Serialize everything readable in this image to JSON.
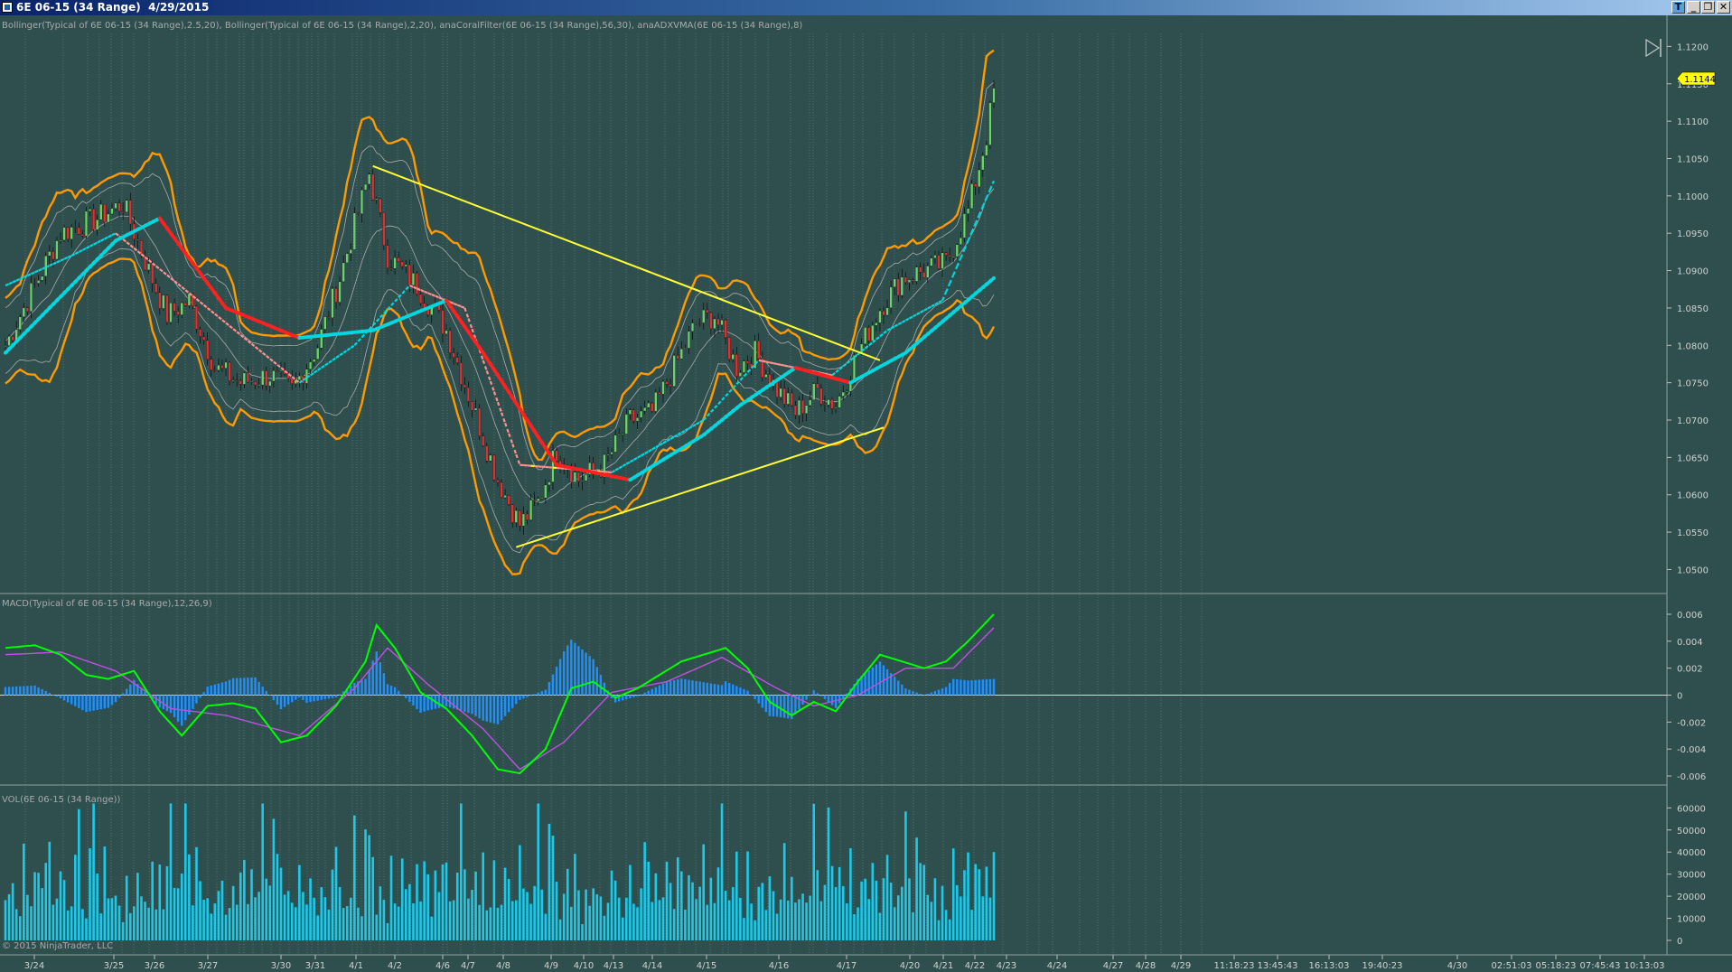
{
  "window": {
    "title": "6E 06-15 (34 Range)  4/29/2015",
    "buttons": [
      "_",
      "❐",
      "✕"
    ],
    "extra_button": "T"
  },
  "panels": {
    "price": {
      "label": "Bollinger(Typical of 6E 06-15 (34 Range),2.5,20), Bollinger(Typical of 6E 06-15 (34 Range),2,20), anaCoralFilter(6E 06-15 (34 Range),56,30), anaADXVMA(6E 06-15 (34 Range),8)",
      "last_price": "1.1144",
      "yaxis_labels": [
        "1.1200",
        "1.1150",
        "1.1100",
        "1.1050",
        "1.1000",
        "1.0950",
        "1.0900",
        "1.0850",
        "1.0800",
        "1.0750",
        "1.0700",
        "1.0650",
        "1.0600",
        "1.0550",
        "1.0500"
      ]
    },
    "macd": {
      "label": "MACD(Typical of 6E 06-15 (34 Range),12,26,9)",
      "yaxis_labels": [
        "0.006",
        "0.004",
        "0.002",
        "0",
        "-0.002",
        "-0.004",
        "-0.006"
      ]
    },
    "volume": {
      "label": "VOL(6E 06-15 (34 Range))",
      "copyright": "© 2015 NinjaTrader, LLC",
      "yaxis_labels": [
        "60000",
        "50000",
        "40000",
        "30000",
        "20000",
        "10000",
        "0"
      ]
    }
  },
  "xaxis_labels": [
    "3/24",
    "3/25",
    "3/26",
    "3/27",
    "3/30",
    "3/31",
    "4/1",
    "4/2",
    "4/6",
    "4/7",
    "4/8",
    "4/9",
    "4/10",
    "4/13",
    "4/14",
    "4/15",
    "4/16",
    "4/17",
    "4/20",
    "4/21",
    "4/22",
    "4/23",
    "4/24",
    "4/27",
    "4/28",
    "4/29",
    "11:18:23",
    "13:45:43",
    "16:13:03",
    "19:40:23",
    "4/30",
    "02:51:03",
    "05:18:23",
    "07:45:43",
    "10:13:03"
  ],
  "colors": {
    "background": "#2f4f4f",
    "bollinger_outer": "#ff9900",
    "bollinger_inner": "#a9a9a9",
    "coral_up": "#00d8e0",
    "coral_down": "#ff2020",
    "adxvma_flat": "#ffff00",
    "trendline": "#ffff33",
    "macd_line": "#00ff00",
    "signal_line": "#c050e0",
    "histogram": "#1e90ff",
    "volume_bars": "#1ec8e8",
    "candle_up": "#6cd36c",
    "candle_down": "#e03030"
  },
  "chart_data": [
    {
      "type": "candlestick",
      "title": "6E 06-15 (34 Range)",
      "ylim": [
        1.048,
        1.1215
      ],
      "grid": true,
      "anchors_price": [
        [
          0,
          1.08
        ],
        [
          8,
          1.088
        ],
        [
          15,
          1.095
        ],
        [
          25,
          1.097
        ],
        [
          32,
          1.099
        ],
        [
          39,
          1.09
        ],
        [
          44,
          1.084
        ],
        [
          50,
          1.086
        ],
        [
          57,
          1.077
        ],
        [
          64,
          1.075
        ],
        [
          72,
          1.076
        ],
        [
          78,
          1.074
        ],
        [
          85,
          1.08
        ],
        [
          91,
          1.089
        ],
        [
          99,
          1.103
        ],
        [
          104,
          1.092
        ],
        [
          112,
          1.088
        ],
        [
          120,
          1.082
        ],
        [
          127,
          1.072
        ],
        [
          134,
          1.062
        ],
        [
          140,
          1.056
        ],
        [
          145,
          1.059
        ],
        [
          150,
          1.066
        ],
        [
          156,
          1.062
        ],
        [
          163,
          1.064
        ],
        [
          170,
          1.07
        ],
        [
          176,
          1.071
        ],
        [
          182,
          1.077
        ],
        [
          188,
          1.083
        ],
        [
          193,
          1.084
        ],
        [
          199,
          1.077
        ],
        [
          204,
          1.079
        ],
        [
          210,
          1.074
        ],
        [
          215,
          1.071
        ],
        [
          221,
          1.074
        ],
        [
          226,
          1.072
        ],
        [
          232,
          1.079
        ],
        [
          238,
          1.085
        ],
        [
          244,
          1.089
        ],
        [
          250,
          1.09
        ],
        [
          256,
          1.091
        ],
        [
          262,
          1.098
        ],
        [
          267,
          1.108
        ],
        [
          269,
          1.114
        ]
      ],
      "coral_filter": [
        [
          0,
          1.079
        ],
        [
          30,
          1.094
        ],
        [
          42,
          1.097
        ],
        [
          60,
          1.085
        ],
        [
          80,
          1.081
        ],
        [
          100,
          1.082
        ],
        [
          120,
          1.086
        ],
        [
          130,
          1.079
        ],
        [
          150,
          1.064
        ],
        [
          170,
          1.062
        ],
        [
          190,
          1.068
        ],
        [
          200,
          1.072
        ],
        [
          215,
          1.077
        ],
        [
          230,
          1.075
        ],
        [
          245,
          1.079
        ],
        [
          269,
          1.089
        ]
      ],
      "adxvma": [
        [
          0,
          1.088
        ],
        [
          18,
          1.092
        ],
        [
          30,
          1.095
        ],
        [
          50,
          1.087
        ],
        [
          80,
          1.075
        ],
        [
          95,
          1.08
        ],
        [
          110,
          1.088
        ],
        [
          125,
          1.085
        ],
        [
          140,
          1.064
        ],
        [
          165,
          1.063
        ],
        [
          190,
          1.07
        ],
        [
          205,
          1.078
        ],
        [
          225,
          1.076
        ],
        [
          240,
          1.082
        ],
        [
          255,
          1.086
        ],
        [
          269,
          1.102
        ]
      ],
      "trendlines": [
        {
          "from": [
            100,
            1.104
          ],
          "to": [
            238,
            1.078
          ]
        },
        {
          "from": [
            139,
            1.053
          ],
          "to": [
            239,
            1.069
          ]
        }
      ]
    },
    {
      "type": "line",
      "title": "MACD(Typical of 6E 06-15 (34 Range),12,26,9)",
      "ylim": [
        -0.0064,
        0.0062
      ],
      "series": [
        {
          "values": [
            [
              0,
              0.0035
            ],
            [
              8,
              0.0037
            ],
            [
              15,
              0.003
            ],
            [
              22,
              0.0015
            ],
            [
              28,
              0.0012
            ],
            [
              35,
              0.0018
            ],
            [
              42,
              -0.0012
            ],
            [
              48,
              -0.003
            ],
            [
              55,
              -0.0008
            ],
            [
              62,
              -0.0006
            ],
            [
              68,
              -0.001
            ],
            [
              75,
              -0.0035
            ],
            [
              82,
              -0.003
            ],
            [
              90,
              -0.0008
            ],
            [
              98,
              0.0025
            ],
            [
              101,
              0.0052
            ],
            [
              106,
              0.0035
            ],
            [
              113,
              0.0002
            ],
            [
              120,
              -0.001
            ],
            [
              127,
              -0.003
            ],
            [
              134,
              -0.0055
            ],
            [
              140,
              -0.0058
            ],
            [
              147,
              -0.004
            ],
            [
              154,
              0.0005
            ],
            [
              160,
              0.001
            ],
            [
              166,
              -0.0002
            ],
            [
              172,
              0.0005
            ],
            [
              178,
              0.0015
            ],
            [
              184,
              0.0025
            ],
            [
              190,
              0.003
            ],
            [
              196,
              0.0035
            ],
            [
              202,
              0.002
            ],
            [
              208,
              -0.0005
            ],
            [
              214,
              -0.0015
            ],
            [
              220,
              -0.0005
            ],
            [
              226,
              -0.0012
            ],
            [
              232,
              0.001
            ],
            [
              238,
              0.003
            ],
            [
              244,
              0.0025
            ],
            [
              250,
              0.002
            ],
            [
              256,
              0.0025
            ],
            [
              262,
              0.004
            ],
            [
              269,
              0.006
            ]
          ]
        },
        {
          "values": [
            [
              0,
              0.003
            ],
            [
              15,
              0.0032
            ],
            [
              30,
              0.0018
            ],
            [
              45,
              -0.001
            ],
            [
              60,
              -0.0015
            ],
            [
              80,
              -0.003
            ],
            [
              95,
              0.0005
            ],
            [
              104,
              0.0035
            ],
            [
              115,
              0.0008
            ],
            [
              130,
              -0.0025
            ],
            [
              140,
              -0.0055
            ],
            [
              152,
              -0.0035
            ],
            [
              165,
              0.0002
            ],
            [
              180,
              0.001
            ],
            [
              195,
              0.0028
            ],
            [
              210,
              0.0005
            ],
            [
              220,
              -0.0008
            ],
            [
              232,
              0.0
            ],
            [
              245,
              0.002
            ],
            [
              258,
              0.002
            ],
            [
              269,
              0.005
            ]
          ]
        }
      ],
      "histogram": true
    },
    {
      "type": "bar",
      "title": "VOL(6E 06-15 (34 Range))",
      "ylim": [
        0,
        63000
      ],
      "bar_count": 270,
      "note_values_sampled": [
        27000,
        17000,
        30000,
        25000,
        14000,
        33000,
        21000,
        12000,
        29000,
        22000,
        18000,
        26000,
        35000,
        13000,
        25000,
        31000,
        19000,
        24000,
        16000,
        28000,
        52000,
        23000,
        18000,
        39000,
        62000
      ]
    }
  ]
}
